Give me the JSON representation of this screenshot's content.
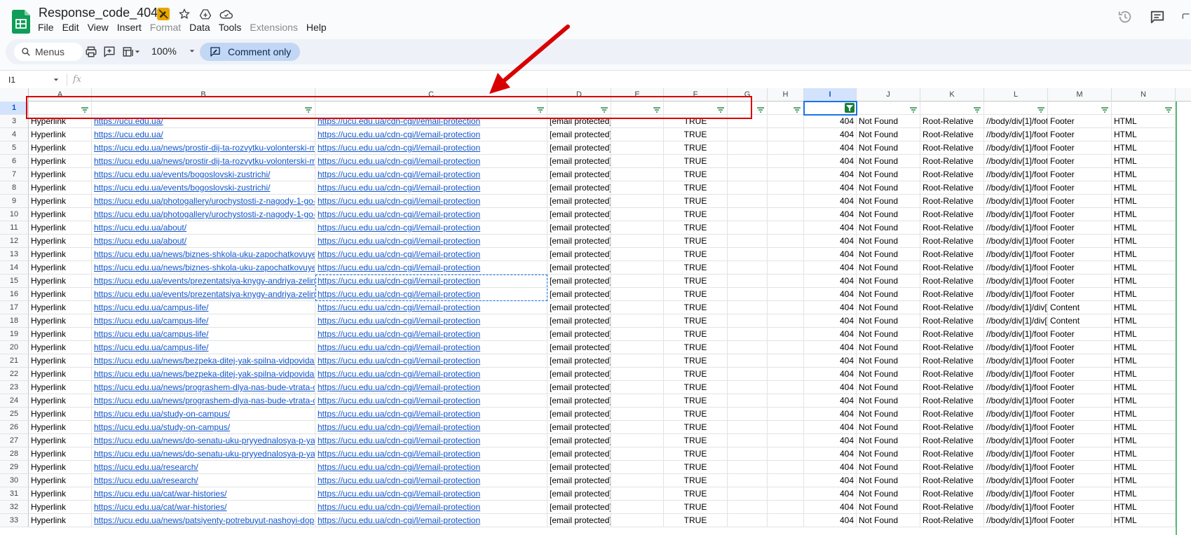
{
  "doc": {
    "title": "Response_code_404"
  },
  "menu": [
    "File",
    "Edit",
    "View",
    "Insert",
    "Format",
    "Data",
    "Tools",
    "Extensions",
    "Help"
  ],
  "menu_disabled": [
    "Format",
    "Extensions"
  ],
  "toolbar": {
    "search_label": "Menus",
    "zoom": "100%",
    "mode_label": "Comment only"
  },
  "formula_bar": {
    "cell_ref": "I1",
    "fx": "fx"
  },
  "columns": [
    "A",
    "B",
    "C",
    "D",
    "E",
    "F",
    "G",
    "H",
    "I",
    "J",
    "K",
    "L",
    "M",
    "N"
  ],
  "selected_column": "I",
  "selected_row": "1",
  "rows": [
    {
      "n": "1",
      "cells": [
        "",
        "",
        "",
        "",
        "",
        "",
        "",
        "",
        "",
        "",
        "",
        "",
        "",
        ""
      ]
    },
    {
      "n": "3",
      "cells": [
        "Hyperlink",
        "https://ucu.edu.ua/",
        "https://ucu.edu.ua/cdn-cgi/l/email-protection",
        "[email protected]",
        "",
        "TRUE",
        "",
        "",
        "404",
        "Not Found",
        "Root-Relative",
        "//body/div[1]/foot",
        "Footer",
        "HTML"
      ]
    },
    {
      "n": "4",
      "cells": [
        "Hyperlink",
        "https://ucu.edu.ua/",
        "https://ucu.edu.ua/cdn-cgi/l/email-protection",
        "[email protected]",
        "",
        "TRUE",
        "",
        "",
        "404",
        "Not Found",
        "Root-Relative",
        "//body/div[1]/foot",
        "Footer",
        "HTML"
      ]
    },
    {
      "n": "5",
      "cells": [
        "Hyperlink",
        "https://ucu.edu.ua/news/prostir-dij-ta-rozvytku-volonterski-m",
        "https://ucu.edu.ua/cdn-cgi/l/email-protection",
        "[email protected]",
        "",
        "TRUE",
        "",
        "",
        "404",
        "Not Found",
        "Root-Relative",
        "//body/div[1]/foot",
        "Footer",
        "HTML"
      ]
    },
    {
      "n": "6",
      "cells": [
        "Hyperlink",
        "https://ucu.edu.ua/news/prostir-dij-ta-rozvytku-volonterski-m",
        "https://ucu.edu.ua/cdn-cgi/l/email-protection",
        "[email protected]",
        "",
        "TRUE",
        "",
        "",
        "404",
        "Not Found",
        "Root-Relative",
        "//body/div[1]/foot",
        "Footer",
        "HTML"
      ]
    },
    {
      "n": "7",
      "cells": [
        "Hyperlink",
        "https://ucu.edu.ua/events/bogoslovski-zustrichi/",
        "https://ucu.edu.ua/cdn-cgi/l/email-protection",
        "[email protected]",
        "",
        "TRUE",
        "",
        "",
        "404",
        "Not Found",
        "Root-Relative",
        "//body/div[1]/foot",
        "Footer",
        "HTML"
      ]
    },
    {
      "n": "8",
      "cells": [
        "Hyperlink",
        "https://ucu.edu.ua/events/bogoslovski-zustrichi/",
        "https://ucu.edu.ua/cdn-cgi/l/email-protection",
        "[email protected]",
        "",
        "TRUE",
        "",
        "",
        "404",
        "Not Found",
        "Root-Relative",
        "//body/div[1]/foot",
        "Footer",
        "HTML"
      ]
    },
    {
      "n": "9",
      "cells": [
        "Hyperlink",
        "https://ucu.edu.ua/photogallery/urochystosti-z-nagody-1-go-",
        "https://ucu.edu.ua/cdn-cgi/l/email-protection",
        "[email protected]",
        "",
        "TRUE",
        "",
        "",
        "404",
        "Not Found",
        "Root-Relative",
        "//body/div[1]/foot",
        "Footer",
        "HTML"
      ]
    },
    {
      "n": "10",
      "cells": [
        "Hyperlink",
        "https://ucu.edu.ua/photogallery/urochystosti-z-nagody-1-go-",
        "https://ucu.edu.ua/cdn-cgi/l/email-protection",
        "[email protected]",
        "",
        "TRUE",
        "",
        "",
        "404",
        "Not Found",
        "Root-Relative",
        "//body/div[1]/foot",
        "Footer",
        "HTML"
      ]
    },
    {
      "n": "11",
      "cells": [
        "Hyperlink",
        "https://ucu.edu.ua/about/",
        "https://ucu.edu.ua/cdn-cgi/l/email-protection",
        "[email protected]",
        "",
        "TRUE",
        "",
        "",
        "404",
        "Not Found",
        "Root-Relative",
        "//body/div[1]/foot",
        "Footer",
        "HTML"
      ]
    },
    {
      "n": "12",
      "cells": [
        "Hyperlink",
        "https://ucu.edu.ua/about/",
        "https://ucu.edu.ua/cdn-cgi/l/email-protection",
        "[email protected]",
        "",
        "TRUE",
        "",
        "",
        "404",
        "Not Found",
        "Root-Relative",
        "//body/div[1]/foot",
        "Footer",
        "HTML"
      ]
    },
    {
      "n": "13",
      "cells": [
        "Hyperlink",
        "https://ucu.edu.ua/news/biznes-shkola-uku-zapochatkovuye",
        "https://ucu.edu.ua/cdn-cgi/l/email-protection",
        "[email protected]",
        "",
        "TRUE",
        "",
        "",
        "404",
        "Not Found",
        "Root-Relative",
        "//body/div[1]/foot",
        "Footer",
        "HTML"
      ]
    },
    {
      "n": "14",
      "cells": [
        "Hyperlink",
        "https://ucu.edu.ua/news/biznes-shkola-uku-zapochatkovuye",
        "https://ucu.edu.ua/cdn-cgi/l/email-protection",
        "[email protected]",
        "",
        "TRUE",
        "",
        "",
        "404",
        "Not Found",
        "Root-Relative",
        "//body/div[1]/foot",
        "Footer",
        "HTML"
      ]
    },
    {
      "n": "15",
      "cells": [
        "Hyperlink",
        "https://ucu.edu.ua/events/prezentatsiya-knygy-andriya-zelin",
        "https://ucu.edu.ua/cdn-cgi/l/email-protection",
        "[email protected]",
        "",
        "TRUE",
        "",
        "",
        "404",
        "Not Found",
        "Root-Relative",
        "//body/div[1]/foot",
        "Footer",
        "HTML"
      ]
    },
    {
      "n": "16",
      "cells": [
        "Hyperlink",
        "https://ucu.edu.ua/events/prezentatsiya-knygy-andriya-zelin",
        "https://ucu.edu.ua/cdn-cgi/l/email-protection",
        "[email protected]",
        "",
        "TRUE",
        "",
        "",
        "404",
        "Not Found",
        "Root-Relative",
        "//body/div[1]/foot",
        "Footer",
        "HTML"
      ]
    },
    {
      "n": "17",
      "cells": [
        "Hyperlink",
        "https://ucu.edu.ua/campus-life/",
        "https://ucu.edu.ua/cdn-cgi/l/email-protection",
        "[email protected]",
        "",
        "TRUE",
        "",
        "",
        "404",
        "Not Found",
        "Root-Relative",
        "//body/div[1]/div[",
        "Content",
        "HTML"
      ]
    },
    {
      "n": "18",
      "cells": [
        "Hyperlink",
        "https://ucu.edu.ua/campus-life/",
        "https://ucu.edu.ua/cdn-cgi/l/email-protection",
        "[email protected]",
        "",
        "TRUE",
        "",
        "",
        "404",
        "Not Found",
        "Root-Relative",
        "//body/div[1]/div[",
        "Content",
        "HTML"
      ]
    },
    {
      "n": "19",
      "cells": [
        "Hyperlink",
        "https://ucu.edu.ua/campus-life/",
        "https://ucu.edu.ua/cdn-cgi/l/email-protection",
        "[email protected]",
        "",
        "TRUE",
        "",
        "",
        "404",
        "Not Found",
        "Root-Relative",
        "//body/div[1]/foot",
        "Footer",
        "HTML"
      ]
    },
    {
      "n": "20",
      "cells": [
        "Hyperlink",
        "https://ucu.edu.ua/campus-life/",
        "https://ucu.edu.ua/cdn-cgi/l/email-protection",
        "[email protected]",
        "",
        "TRUE",
        "",
        "",
        "404",
        "Not Found",
        "Root-Relative",
        "//body/div[1]/foot",
        "Footer",
        "HTML"
      ]
    },
    {
      "n": "21",
      "cells": [
        "Hyperlink",
        "https://ucu.edu.ua/news/bezpeka-ditej-yak-spilna-vidpovidal",
        "https://ucu.edu.ua/cdn-cgi/l/email-protection",
        "[email protected]",
        "",
        "TRUE",
        "",
        "",
        "404",
        "Not Found",
        "Root-Relative",
        "//body/div[1]/foot",
        "Footer",
        "HTML"
      ]
    },
    {
      "n": "22",
      "cells": [
        "Hyperlink",
        "https://ucu.edu.ua/news/bezpeka-ditej-yak-spilna-vidpovidal",
        "https://ucu.edu.ua/cdn-cgi/l/email-protection",
        "[email protected]",
        "",
        "TRUE",
        "",
        "",
        "404",
        "Not Found",
        "Root-Relative",
        "//body/div[1]/foot",
        "Footer",
        "HTML"
      ]
    },
    {
      "n": "23",
      "cells": [
        "Hyperlink",
        "https://ucu.edu.ua/news/prograshem-dlya-nas-bude-vtrata-c",
        "https://ucu.edu.ua/cdn-cgi/l/email-protection",
        "[email protected]",
        "",
        "TRUE",
        "",
        "",
        "404",
        "Not Found",
        "Root-Relative",
        "//body/div[1]/foot",
        "Footer",
        "HTML"
      ]
    },
    {
      "n": "24",
      "cells": [
        "Hyperlink",
        "https://ucu.edu.ua/news/prograshem-dlya-nas-bude-vtrata-c",
        "https://ucu.edu.ua/cdn-cgi/l/email-protection",
        "[email protected]",
        "",
        "TRUE",
        "",
        "",
        "404",
        "Not Found",
        "Root-Relative",
        "//body/div[1]/foot",
        "Footer",
        "HTML"
      ]
    },
    {
      "n": "25",
      "cells": [
        "Hyperlink",
        "https://ucu.edu.ua/study-on-campus/",
        "https://ucu.edu.ua/cdn-cgi/l/email-protection",
        "[email protected]",
        "",
        "TRUE",
        "",
        "",
        "404",
        "Not Found",
        "Root-Relative",
        "//body/div[1]/foot",
        "Footer",
        "HTML"
      ]
    },
    {
      "n": "26",
      "cells": [
        "Hyperlink",
        "https://ucu.edu.ua/study-on-campus/",
        "https://ucu.edu.ua/cdn-cgi/l/email-protection",
        "[email protected]",
        "",
        "TRUE",
        "",
        "",
        "404",
        "Not Found",
        "Root-Relative",
        "//body/div[1]/foot",
        "Footer",
        "HTML"
      ]
    },
    {
      "n": "27",
      "cells": [
        "Hyperlink",
        "https://ucu.edu.ua/news/do-senatu-uku-pryyednalosya-p-ya",
        "https://ucu.edu.ua/cdn-cgi/l/email-protection",
        "[email protected]",
        "",
        "TRUE",
        "",
        "",
        "404",
        "Not Found",
        "Root-Relative",
        "//body/div[1]/foot",
        "Footer",
        "HTML"
      ]
    },
    {
      "n": "28",
      "cells": [
        "Hyperlink",
        "https://ucu.edu.ua/news/do-senatu-uku-pryyednalosya-p-ya",
        "https://ucu.edu.ua/cdn-cgi/l/email-protection",
        "[email protected]",
        "",
        "TRUE",
        "",
        "",
        "404",
        "Not Found",
        "Root-Relative",
        "//body/div[1]/foot",
        "Footer",
        "HTML"
      ]
    },
    {
      "n": "29",
      "cells": [
        "Hyperlink",
        "https://ucu.edu.ua/research/",
        "https://ucu.edu.ua/cdn-cgi/l/email-protection",
        "[email protected]",
        "",
        "TRUE",
        "",
        "",
        "404",
        "Not Found",
        "Root-Relative",
        "//body/div[1]/foot",
        "Footer",
        "HTML"
      ]
    },
    {
      "n": "30",
      "cells": [
        "Hyperlink",
        "https://ucu.edu.ua/research/",
        "https://ucu.edu.ua/cdn-cgi/l/email-protection",
        "[email protected]",
        "",
        "TRUE",
        "",
        "",
        "404",
        "Not Found",
        "Root-Relative",
        "//body/div[1]/foot",
        "Footer",
        "HTML"
      ]
    },
    {
      "n": "31",
      "cells": [
        "Hyperlink",
        "https://ucu.edu.ua/cat/war-histories/",
        "https://ucu.edu.ua/cdn-cgi/l/email-protection",
        "[email protected]",
        "",
        "TRUE",
        "",
        "",
        "404",
        "Not Found",
        "Root-Relative",
        "//body/div[1]/foot",
        "Footer",
        "HTML"
      ]
    },
    {
      "n": "32",
      "cells": [
        "Hyperlink",
        "https://ucu.edu.ua/cat/war-histories/",
        "https://ucu.edu.ua/cdn-cgi/l/email-protection",
        "[email protected]",
        "",
        "TRUE",
        "",
        "",
        "404",
        "Not Found",
        "Root-Relative",
        "//body/div[1]/foot",
        "Footer",
        "HTML"
      ]
    },
    {
      "n": "33",
      "cells": [
        "Hyperlink",
        "https://ucu.edu.ua/news/patsiyenty-potrebuyut-nashoyi-dop",
        "https://ucu.edu.ua/cdn-cgi/l/email-protection",
        "[email protected]",
        "",
        "TRUE",
        "",
        "",
        "404",
        "Not Found",
        "Root-Relative",
        "//body/div[1]/foot",
        "Footer",
        "HTML"
      ]
    }
  ],
  "colors": {
    "link": "#1155cc",
    "annotation": "#d80000",
    "filter_active": "#188038",
    "selection": "#1a73e8"
  }
}
